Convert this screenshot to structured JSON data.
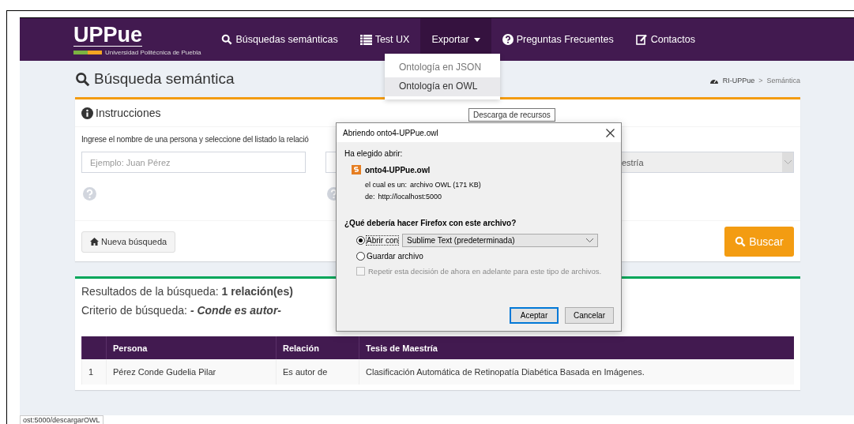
{
  "navbar": {
    "logo": "UPPue",
    "logo_subtitle": "Universidad Politécnica de Puebla",
    "items": [
      {
        "label": "Búsquedas semánticas",
        "kind": "search",
        "expanded": false
      },
      {
        "label": "Test UX",
        "kind": "list",
        "expanded": false
      },
      {
        "label": "Exportar",
        "kind": "dropdown",
        "expanded": true
      },
      {
        "label": "Preguntas Frecuentes",
        "kind": "help",
        "expanded": false
      },
      {
        "label": "Contactos",
        "kind": "edit",
        "expanded": false
      }
    ]
  },
  "dropdown_menu": [
    {
      "label": "Ontología en JSON",
      "selected": false
    },
    {
      "label": "Ontología en OWL",
      "selected": true
    }
  ],
  "tooltip": "Descarga de recursos",
  "page_title": "Búsqueda semántica",
  "breadcrumb": {
    "home": "RI-UPPue",
    "separator": ">",
    "current": "Semántica"
  },
  "instructions_panel": {
    "title": "Instrucciones",
    "text": "Ingrese el nombre de una persona y seleccione del listado la relació",
    "name_field": {
      "placeholder": "Ejemplo: Juan Pérez"
    },
    "relation_select": {
      "value": "estría"
    },
    "new_search_button": "Nueva búsqueda",
    "search_button": "Buscar"
  },
  "results_panel": {
    "summary_label": "Resultados de la búsqueda:",
    "summary_count": "1 relación(es)",
    "criteria_label": "Criterio de búsqueda:",
    "criteria_value": "- Conde es autor-",
    "table": {
      "columns": [
        "",
        "Persona",
        "Relación",
        "Tesis de Maestría"
      ],
      "rows": [
        [
          "1",
          "Pérez Conde Gudelia Pilar",
          "Es autor de",
          "Clasificación Automática de Retinopatía Diabética Basada en Imágenes."
        ]
      ]
    }
  },
  "dialog": {
    "title": "Abriendo onto4-UPPue.owl",
    "intro": "Ha elegido abrir:",
    "file_name": "onto4-UPPue.owl",
    "type_label": "el cual es un:",
    "type_value": "archivo OWL (171 KB)",
    "from_label": "de:",
    "from_value": "http://localhost:5000",
    "question": "¿Qué debería hacer Firefox con este archivo?",
    "options": [
      {
        "label": "Abrir con",
        "selected": true
      },
      {
        "label": "Guardar archivo",
        "selected": false
      }
    ],
    "open_with_app": "Sublime Text (predeterminada)",
    "remember": {
      "label": "Repetir esta decisión de ahora en adelante para este tipo de archivos.",
      "checked": false,
      "disabled": true
    },
    "buttons": [
      {
        "label": "Aceptar",
        "default": true
      },
      {
        "label": "Cancelar",
        "default": false
      }
    ]
  },
  "status_bar": "ost:5000/descargarOWL"
}
